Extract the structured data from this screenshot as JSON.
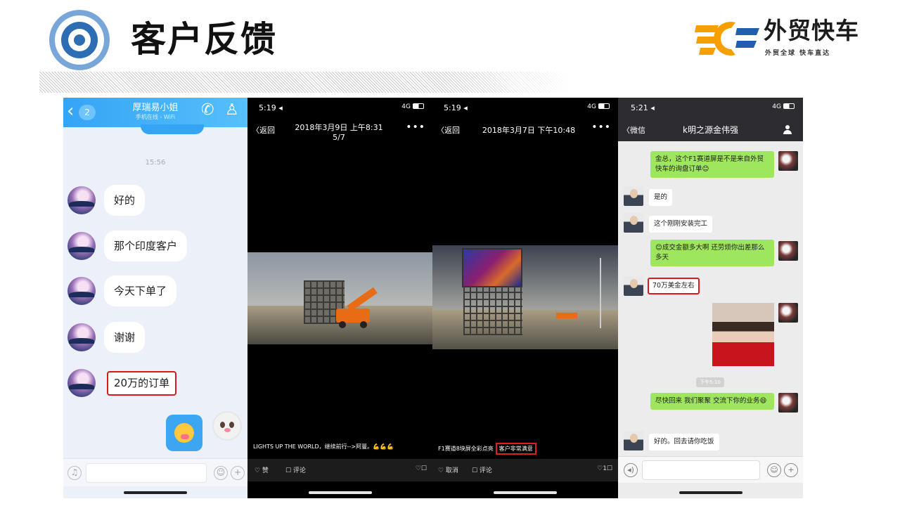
{
  "header": {
    "title": "客户反馈",
    "brand_name": "外贸快车",
    "brand_slogan": "外贸全球 快车直达",
    "accent_color": "#2c6db4",
    "brand_color": "#f5a000"
  },
  "qq_chat": {
    "back_badge": "2",
    "contact_name": "厚瑞易小姐",
    "contact_status": "手机在线 - WiFi",
    "time": "15:56",
    "messages": [
      {
        "text": "好的"
      },
      {
        "text": "那个印度客户"
      },
      {
        "text": "今天下单了"
      },
      {
        "text": "谢谢"
      },
      {
        "text": "20万的订单",
        "highlighted": true
      }
    ],
    "header_icons": [
      "phone-icon",
      "profile-icon"
    ],
    "input_icons": [
      "voice-icon",
      "emoji-icon",
      "plus-icon"
    ]
  },
  "moment_1": {
    "status_time": "5:19 ◂",
    "signal": "4G",
    "back_label": "〈返回",
    "date_line1": "2018年3月9日 上午8:31",
    "date_line2": "5/7",
    "more": "•••",
    "caption": "LIGHTS UP THE WORLD，继续前行-->阿曼。💪💪💪",
    "like_label": "♡ 赞",
    "comment_label": "☐ 评论",
    "right_icons": "♡☐"
  },
  "moment_2": {
    "status_time": "5:19 ◂",
    "signal": "4G",
    "back_label": "〈返回",
    "date": "2018年3月7日 下午10:48",
    "more": "•••",
    "caption": "F1赛道8块屏全彩点亮",
    "caption_highlight": "客户非常满意",
    "like_label": "♡ 取消",
    "comment_label": "☐ 评论",
    "right_icons": "♡1☐"
  },
  "wechat": {
    "status_time": "5:21 ◂",
    "signal": "4G",
    "back_label": "〈微信",
    "contact_name": "k明之源金伟强",
    "time_divider": "下午5:10",
    "messages": [
      {
        "from": "me",
        "text": "金总，这个F1赛道屏是不是来自外贸快车的询盘订单😊"
      },
      {
        "from": "them",
        "text": "是的"
      },
      {
        "from": "them",
        "text": "这个刚刚安装完工"
      },
      {
        "from": "me",
        "text": "😊成交金额多大啊 还劳烦你出差那么多天"
      },
      {
        "from": "them",
        "text": "70万美金左右",
        "highlighted": true
      },
      {
        "from": "me",
        "text": "尽快回来 我们聚聚 交流下你的业务😄"
      },
      {
        "from": "them",
        "text": "好的。回去请你吃饭"
      }
    ]
  }
}
